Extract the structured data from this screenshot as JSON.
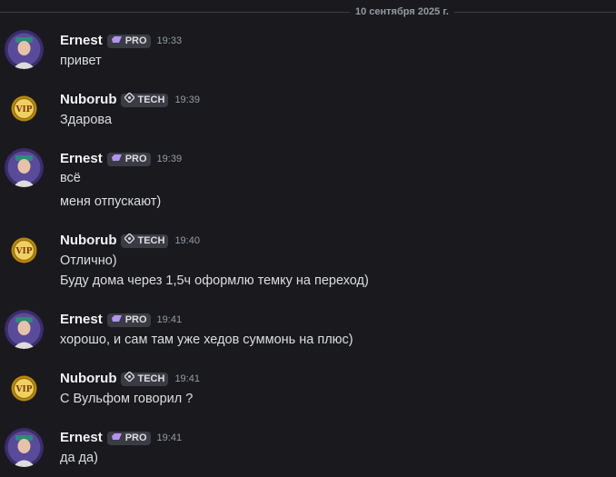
{
  "date_divider": "10 сентября 2025 г.",
  "users": {
    "ernest": {
      "name": "Ernest",
      "tag": "PRO",
      "tag_icon": "pro-gem-icon",
      "tag_color": "#b392f0"
    },
    "nuborub": {
      "name": "Nuborub",
      "tag": "TECH",
      "tag_icon": "tech-diamond-icon",
      "tag_color": "#dbdee1"
    }
  },
  "messages": [
    {
      "author": "Ernest",
      "tag": "PRO",
      "time": "19:33",
      "lines": [
        "привет"
      ]
    },
    {
      "author": "Nuborub",
      "tag": "TECH",
      "time": "19:39",
      "lines": [
        "Здарова"
      ]
    },
    {
      "author": "Ernest",
      "tag": "PRO",
      "time": "19:39",
      "lines": [
        "всё",
        "меня отпускают)"
      ]
    },
    {
      "author": "Nuborub",
      "tag": "TECH",
      "time": "19:40",
      "lines": [
        "Отлично)",
        "Буду дома через 1,5ч оформлю темку на переход)"
      ]
    },
    {
      "author": "Ernest",
      "tag": "PRO",
      "time": "19:41",
      "lines": [
        "хорошо, и сам там уже хедов суммонь на плюс)"
      ]
    },
    {
      "author": "Nuborub",
      "tag": "TECH",
      "time": "19:41",
      "lines": [
        "С Вульфом говорил ?"
      ]
    },
    {
      "author": "Ernest",
      "tag": "PRO",
      "time": "19:41",
      "lines": [
        "да да)"
      ]
    }
  ],
  "colors": {
    "background": "#1a1a1e",
    "text": "#dbdee1",
    "muted": "#949ba4",
    "tag_bg": "#3a3b44"
  }
}
